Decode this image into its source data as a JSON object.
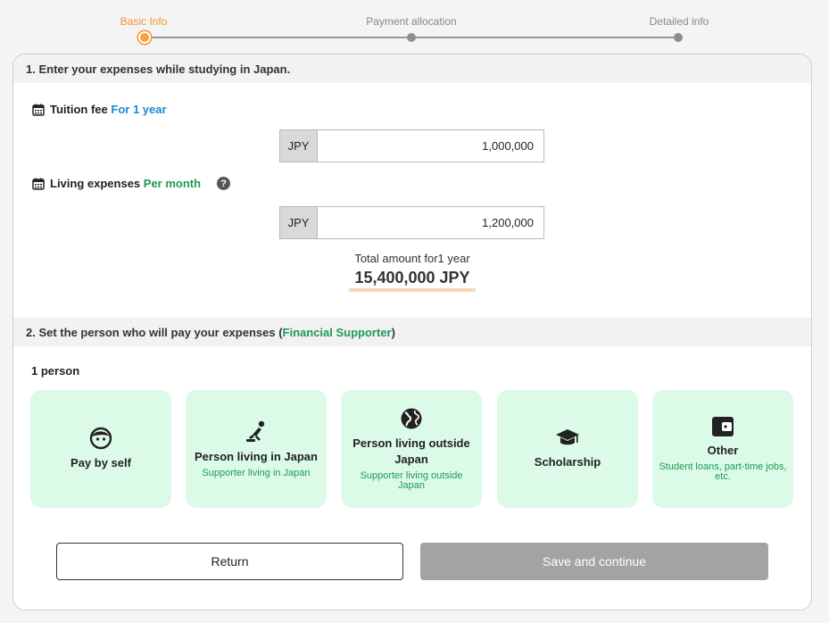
{
  "stepper": {
    "steps": [
      {
        "label": "Basic Info",
        "state": "active"
      },
      {
        "label": "Payment allocation",
        "state": "pending"
      },
      {
        "label": "Detailed info",
        "state": "pending"
      }
    ],
    "colors": {
      "active": "#f0922e",
      "inactive": "#8d8d8d"
    }
  },
  "section1": {
    "title": "1. Enter your expenses while studying in Japan.",
    "tuition": {
      "label": "Tuition fee",
      "period": "For 1 year",
      "currency": "JPY",
      "value": "1,000,000",
      "icon": "calendar-icon"
    },
    "living": {
      "label": "Living expenses",
      "period": "Per month",
      "currency": "JPY",
      "value": "1,200,000",
      "icon": "calendar-icon",
      "help": "?"
    },
    "total_label": "Total amount for1 year",
    "total_value": "15,400,000 JPY"
  },
  "section2": {
    "title_prefix": "2. Set the person who will pay your expenses (",
    "title_highlight": "Financial Supporter",
    "title_suffix": ")",
    "count": "1 person",
    "options": [
      {
        "title": "Pay by self",
        "sub": "",
        "icon": "face-icon"
      },
      {
        "title": "Person living in Japan",
        "sub": "Supporter living in Japan",
        "icon": "person-icon"
      },
      {
        "title": "Person living outside Japan",
        "sub": "Supporter living outside Japan",
        "icon": "globe-icon"
      },
      {
        "title": "Scholarship",
        "sub": "",
        "icon": "graduation-cap-icon"
      },
      {
        "title": "Other",
        "sub": "Student loans, part-time jobs, etc.",
        "icon": "wallet-icon"
      }
    ]
  },
  "actions": {
    "return_label": "Return",
    "save_label": "Save and continue"
  },
  "colors": {
    "accent_green": "#1c9a55",
    "accent_blue": "#1a8ad4",
    "option_bg": "#dcfae8",
    "disabled_button": "#a3a3a3"
  }
}
